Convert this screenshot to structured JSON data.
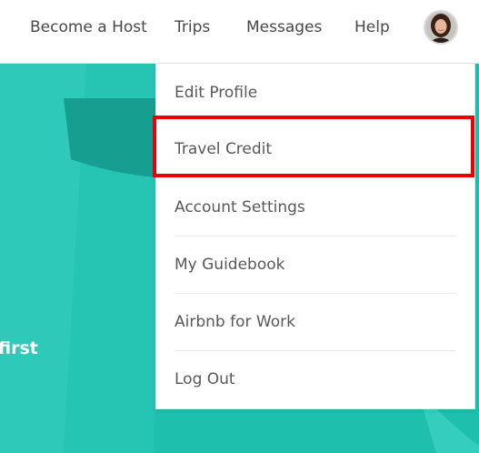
{
  "nav": {
    "become_host": "Become a Host",
    "trips": "Trips",
    "messages": "Messages",
    "help": "Help"
  },
  "hero": {
    "text_fragment": "first"
  },
  "menu": {
    "items": [
      {
        "label": "Edit Profile"
      },
      {
        "label": "Travel Credit",
        "highlighted": true
      },
      {
        "label": "Account Settings"
      },
      {
        "label": "My Guidebook"
      },
      {
        "label": "Airbnb for Work"
      },
      {
        "label": "Log Out"
      }
    ]
  },
  "colors": {
    "hero_teal": "#1fbfae",
    "text": "#484848",
    "highlight": "#ea0000"
  },
  "icons": {
    "avatar": "user-avatar-photo"
  }
}
